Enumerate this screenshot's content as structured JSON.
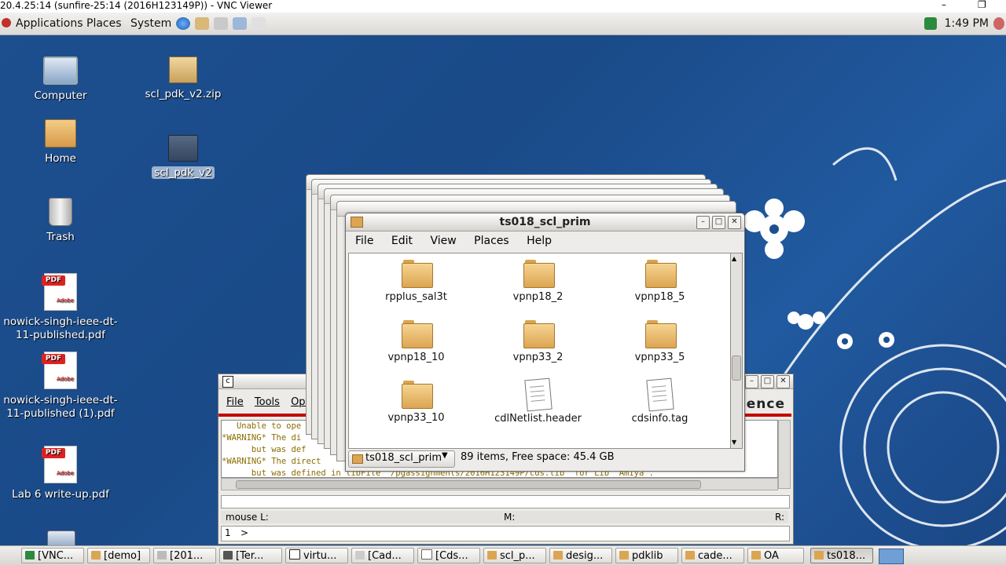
{
  "vnc": {
    "title": "20.4.25:14 (sunfire-25:14 (2016H123149P)) - VNC Viewer",
    "minimize": "–",
    "restore": "❐"
  },
  "panel": {
    "menus": [
      "Applications",
      "Places",
      "System"
    ],
    "clock": "1:49 PM"
  },
  "desktop": [
    {
      "label": "Computer"
    },
    {
      "label": "scl_pdk_v2.zip"
    },
    {
      "label": "Home"
    },
    {
      "label": "scl_pdk_v2"
    },
    {
      "label": "Trash"
    },
    {
      "label": "nowick-singh-ieee-dt-11-published.pdf"
    },
    {
      "label": "nowick-singh-ieee-dt-11-published (1).pdf"
    },
    {
      "label": "Lab 6 write-up.pdf"
    }
  ],
  "pdf_badge": "PDF",
  "pdf_brand": "Adobe",
  "file_manager": {
    "title": "ts018_scl_prim",
    "menus": [
      "File",
      "Edit",
      "View",
      "Places",
      "Help"
    ],
    "items": [
      "rpplus_sal3t",
      "vpnp18_2",
      "vpnp18_5",
      "vpnp18_10",
      "vpnp33_2",
      "vpnp33_5",
      "vpnp33_10",
      "cdlNetlist.header",
      "cdsinfo.tag"
    ],
    "path": "ts018_scl_prim",
    "status": "89 items, Free space: 45.4 GB"
  },
  "terminal": {
    "menus": [
      "File",
      "Tools",
      "Opt"
    ],
    "brand": "lence",
    "log": [
      "   Unable to ope",
      "*WARNING* The di",
      "      but was def",
      "*WARNING* The direct",
      "      but was defined in libFile \"/pgassignments/2016H123149P/cds.lib\" for Lib \"Amiya\"."
    ],
    "status_left": "mouse L:",
    "status_mid": "M:",
    "status_right": "R:",
    "line_no": "1",
    "prompt": ">"
  },
  "taskbar": [
    "[VNC...",
    "[demo]",
    "[201...",
    "[Ter...",
    "virtu...",
    "[Cad...",
    "[Cds...",
    "scl_p...",
    "desig...",
    "pdklib",
    "cade...",
    "OA",
    "ts018..."
  ],
  "colors": {
    "desktop": "#1d4f8f",
    "terminal_accent": "#c40000",
    "folder": "#dca552"
  }
}
